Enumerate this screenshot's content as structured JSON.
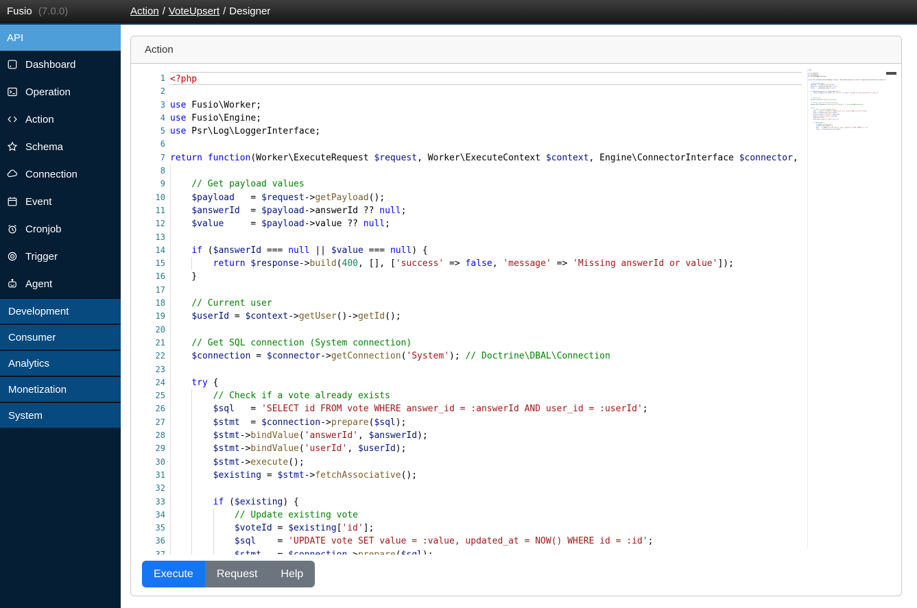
{
  "topbar": {
    "brand": "Fusio",
    "version": "(7.0.0)",
    "breadcrumb": [
      {
        "label": "Action",
        "link": true
      },
      {
        "label": "VoteUpsert",
        "link": true
      },
      {
        "label": "Designer",
        "link": false
      }
    ],
    "separator": "/"
  },
  "sidebar": {
    "items": [
      {
        "label": "API",
        "icon": null,
        "active": true
      },
      {
        "label": "Dashboard",
        "icon": "dashboard",
        "active": false
      },
      {
        "label": "Operation",
        "icon": "operation",
        "active": false
      },
      {
        "label": "Action",
        "icon": "action",
        "active": false
      },
      {
        "label": "Schema",
        "icon": "schema",
        "active": false
      },
      {
        "label": "Connection",
        "icon": "connection",
        "active": false
      },
      {
        "label": "Event",
        "icon": "event",
        "active": false
      },
      {
        "label": "Cronjob",
        "icon": "cronjob",
        "active": false
      },
      {
        "label": "Trigger",
        "icon": "trigger",
        "active": false
      },
      {
        "label": "Agent",
        "icon": "agent",
        "active": false
      }
    ],
    "sections": [
      "Development",
      "Consumer",
      "Analytics",
      "Monetization",
      "System"
    ]
  },
  "panel": {
    "title": "Action"
  },
  "editor": {
    "current_line": 1,
    "lines": [
      "<?php",
      "",
      "use Fusio\\Worker;",
      "use Fusio\\Engine;",
      "use Psr\\Log\\LoggerInterface;",
      "",
      "return function(Worker\\ExecuteRequest $request, Worker\\ExecuteContext $context, Engine\\ConnectorInterface $connector,",
      "",
      "    // Get payload values",
      "    $payload   = $request->getPayload();",
      "    $answerId  = $payload->answerId ?? null;",
      "    $value     = $payload->value ?? null;",
      "",
      "    if ($answerId === null || $value === null) {",
      "        return $response->build(400, [], ['success' => false, 'message' => 'Missing answerId or value']);",
      "    }",
      "",
      "    // Current user",
      "    $userId = $context->getUser()->getId();",
      "",
      "    // Get SQL connection (System connection)",
      "    $connection = $connector->getConnection('System'); // Doctrine\\DBAL\\Connection",
      "",
      "    try {",
      "        // Check if a vote already exists",
      "        $sql   = 'SELECT id FROM vote WHERE answer_id = :answerId AND user_id = :userId';",
      "        $stmt  = $connection->prepare($sql);",
      "        $stmt->bindValue('answerId', $answerId);",
      "        $stmt->bindValue('userId', $userId);",
      "        $stmt->execute();",
      "        $existing = $stmt->fetchAssociative();",
      "",
      "        if ($existing) {",
      "            // Update existing vote",
      "            $voteId = $existing['id'];",
      "            $sql    = 'UPDATE vote SET value = :value, updated_at = NOW() WHERE id = :id';",
      "            $stmt   = $connection->prepare($sql);"
    ]
  },
  "footer": {
    "buttons": [
      {
        "label": "Execute",
        "variant": "primary"
      },
      {
        "label": "Request",
        "variant": "secondary"
      },
      {
        "label": "Help",
        "variant": "secondary"
      }
    ]
  },
  "colors": {
    "primary_button": "#1675f2",
    "secondary_button": "#6c757d",
    "sidebar_active": "#4e9fd9",
    "sidebar_bg": "#061e33",
    "sidebar_section_bg": "#074a80"
  }
}
